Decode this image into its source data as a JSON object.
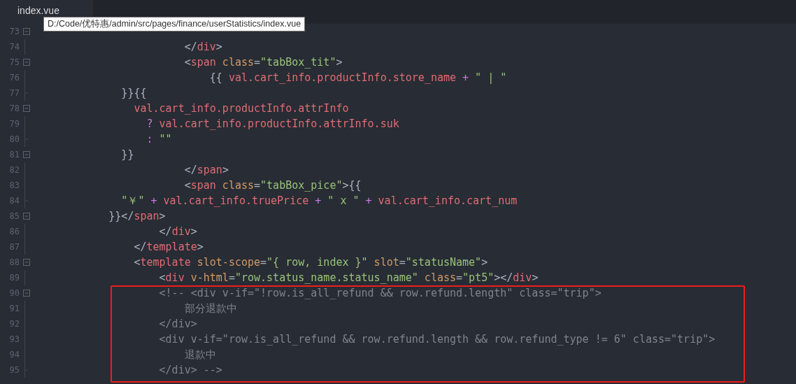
{
  "tabs": [
    {
      "label": "index.vue",
      "selected": true
    }
  ],
  "tooltip": {
    "text": "D:/Code/优特惠/admin/src/pages/finance/userStatistics/index.vue"
  },
  "editor": {
    "lines": [
      {
        "number": "73",
        "foldable": true
      },
      {
        "number": "74",
        "foldable": false,
        "fold_end": false,
        "tokens": [
          {
            "kind": "punct",
            "text": "                      </"
          },
          {
            "kind": "tag",
            "text": "div"
          },
          {
            "kind": "punct",
            "text": ">"
          }
        ]
      },
      {
        "number": "75",
        "foldable": true,
        "tokens": [
          {
            "kind": "punct",
            "text": "                      <"
          },
          {
            "kind": "tag",
            "text": "span"
          },
          {
            "kind": "attr",
            "text": " class"
          },
          {
            "kind": "punct",
            "text": "="
          },
          {
            "kind": "string",
            "text": "\"tabBox_tit\""
          },
          {
            "kind": "punct",
            "text": ">"
          }
        ]
      },
      {
        "number": "76",
        "foldable": false,
        "fold_end": false,
        "tokens": [
          {
            "kind": "punct",
            "text": "                          {{ "
          },
          {
            "kind": "var",
            "text": "val.cart_info.productInfo.store_name"
          },
          {
            "kind": "op",
            "text": " + "
          },
          {
            "kind": "string",
            "text": "\" | \""
          }
        ]
      },
      {
        "number": "77",
        "foldable": false,
        "fold_end": true,
        "tokens": [
          {
            "kind": "punct",
            "text": "            }}{{"
          }
        ]
      },
      {
        "number": "78",
        "foldable": true,
        "tokens": [
          {
            "kind": "var",
            "text": "              val.cart_info.productInfo.attrInfo"
          }
        ]
      },
      {
        "number": "79",
        "foldable": false,
        "fold_end": false,
        "tokens": [
          {
            "kind": "op",
            "text": "                ? "
          },
          {
            "kind": "var",
            "text": "val.cart_info.productInfo.attrInfo.suk"
          }
        ]
      },
      {
        "number": "80",
        "foldable": false,
        "fold_end": true,
        "tokens": [
          {
            "kind": "op",
            "text": "                : "
          },
          {
            "kind": "string",
            "text": "\"\""
          }
        ]
      },
      {
        "number": "81",
        "foldable": true,
        "tokens": [
          {
            "kind": "punct",
            "text": "            }}"
          }
        ]
      },
      {
        "number": "82",
        "foldable": false,
        "fold_end": false,
        "tokens": [
          {
            "kind": "punct",
            "text": "                      </"
          },
          {
            "kind": "tag",
            "text": "span"
          },
          {
            "kind": "punct",
            "text": ">"
          }
        ]
      },
      {
        "number": "83",
        "foldable": false,
        "fold_end": false,
        "tokens": [
          {
            "kind": "punct",
            "text": "                      <"
          },
          {
            "kind": "tag",
            "text": "span"
          },
          {
            "kind": "attr",
            "text": " class"
          },
          {
            "kind": "punct",
            "text": "="
          },
          {
            "kind": "string",
            "text": "\"tabBox_pice\""
          },
          {
            "kind": "punct",
            "text": ">{{"
          }
        ]
      },
      {
        "number": "84",
        "foldable": false,
        "fold_end": true,
        "tokens": [
          {
            "kind": "string",
            "text": "            \"￥\""
          },
          {
            "kind": "op",
            "text": " + "
          },
          {
            "kind": "var",
            "text": "val.cart_info.truePrice"
          },
          {
            "kind": "op",
            "text": " + "
          },
          {
            "kind": "string",
            "text": "\" x \""
          },
          {
            "kind": "op",
            "text": " + "
          },
          {
            "kind": "var",
            "text": "val.cart_info.cart_num"
          }
        ]
      },
      {
        "number": "85",
        "foldable": true,
        "tokens": [
          {
            "kind": "punct",
            "text": "          }}</"
          },
          {
            "kind": "tag",
            "text": "span"
          },
          {
            "kind": "punct",
            "text": ">"
          }
        ]
      },
      {
        "number": "86",
        "foldable": false,
        "fold_end": false,
        "tokens": [
          {
            "kind": "punct",
            "text": "                  </"
          },
          {
            "kind": "tag",
            "text": "div"
          },
          {
            "kind": "punct",
            "text": ">"
          }
        ]
      },
      {
        "number": "87",
        "foldable": false,
        "fold_end": false,
        "tokens": [
          {
            "kind": "punct",
            "text": "              </"
          },
          {
            "kind": "tag",
            "text": "template"
          },
          {
            "kind": "punct",
            "text": ">"
          }
        ]
      },
      {
        "number": "88",
        "foldable": true,
        "tokens": [
          {
            "kind": "punct",
            "text": "              <"
          },
          {
            "kind": "tag",
            "text": "template"
          },
          {
            "kind": "attr",
            "text": " slot-scope"
          },
          {
            "kind": "punct",
            "text": "="
          },
          {
            "kind": "string",
            "text": "\"{ row, index }\""
          },
          {
            "kind": "attr",
            "text": " slot"
          },
          {
            "kind": "punct",
            "text": "="
          },
          {
            "kind": "string",
            "text": "\"statusName\""
          },
          {
            "kind": "punct",
            "text": ">"
          }
        ]
      },
      {
        "number": "89",
        "foldable": false,
        "fold_end": false,
        "tokens": [
          {
            "kind": "punct",
            "text": "                  <"
          },
          {
            "kind": "tag",
            "text": "div"
          },
          {
            "kind": "attr",
            "text": " v-html"
          },
          {
            "kind": "punct",
            "text": "="
          },
          {
            "kind": "string",
            "text": "\"row.status_name.status_name\""
          },
          {
            "kind": "attr",
            "text": " class"
          },
          {
            "kind": "punct",
            "text": "="
          },
          {
            "kind": "string",
            "text": "\"pt5\""
          },
          {
            "kind": "punct",
            "text": "></"
          },
          {
            "kind": "tag",
            "text": "div"
          },
          {
            "kind": "punct",
            "text": ">"
          }
        ]
      },
      {
        "number": "90",
        "foldable": true,
        "tokens": [
          {
            "kind": "comment",
            "text": "                  <!-- <div v-if=\"!row.is_all_refund && row.refund.length\" class=\"trip\">"
          }
        ]
      },
      {
        "number": "91",
        "foldable": false,
        "fold_end": false,
        "tokens": [
          {
            "kind": "comment",
            "text": "                      部分退款中"
          }
        ]
      },
      {
        "number": "92",
        "foldable": false,
        "fold_end": false,
        "tokens": [
          {
            "kind": "comment",
            "text": "                  </div>"
          }
        ]
      },
      {
        "number": "93",
        "foldable": false,
        "fold_end": false,
        "tokens": [
          {
            "kind": "comment",
            "text": "                  <div v-if=\"row.is_all_refund && row.refund.length && row.refund_type != 6\" class=\"trip\">"
          }
        ]
      },
      {
        "number": "94",
        "foldable": false,
        "fold_end": false,
        "tokens": [
          {
            "kind": "comment",
            "text": "                      退款中"
          }
        ]
      },
      {
        "number": "95",
        "foldable": false,
        "fold_end": true,
        "tokens": [
          {
            "kind": "comment",
            "text": "                  </div> -->"
          }
        ]
      }
    ]
  }
}
